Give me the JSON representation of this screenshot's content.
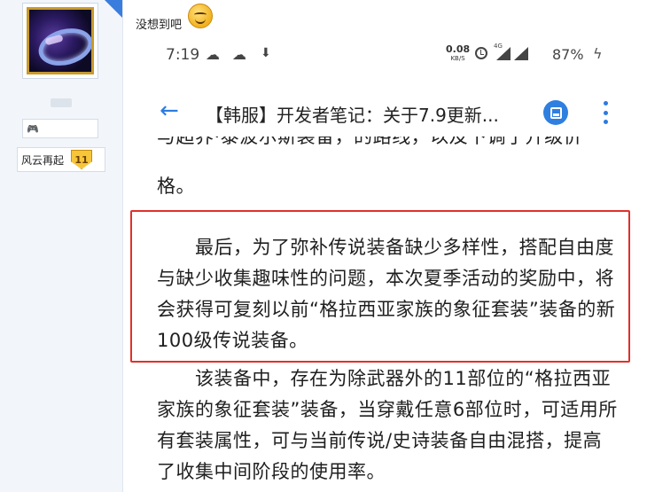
{
  "forum": {
    "post_caption": "没想到吧",
    "rank_label": "风云再起",
    "rank_level": "11"
  },
  "status_bar": {
    "time": "7:19",
    "net_speed": "0.08",
    "net_unit": "KB/S",
    "network_type": "4G",
    "battery": "87%"
  },
  "app_bar": {
    "title": "【韩服】开发者笔记：关于7.9更新..."
  },
  "article": {
    "clipped_line": "与超界·泰波尔斯装备，的路线，以及下调了升级价",
    "p1_tail": "格。",
    "p2": "最后，为了弥补传说装备缺少多样性，搭配自由度与缺少收集趣味性的问题，本次夏季活动的奖励中，将会获得可复刻以前“格拉西亚家族的象征套装”装备的新100级传说装备。",
    "p3": "该装备中，存在为除武器外的11部位的“格拉西亚家族的象征套装”装备，当穿戴任意6部位时，可适用所有套装属性，可与当前传说/史诗装备自由混搭，提高了收集中间阶段的使用率。"
  },
  "colors": {
    "accent_blue": "#2c7be0",
    "highlight_red": "#e0312c"
  }
}
